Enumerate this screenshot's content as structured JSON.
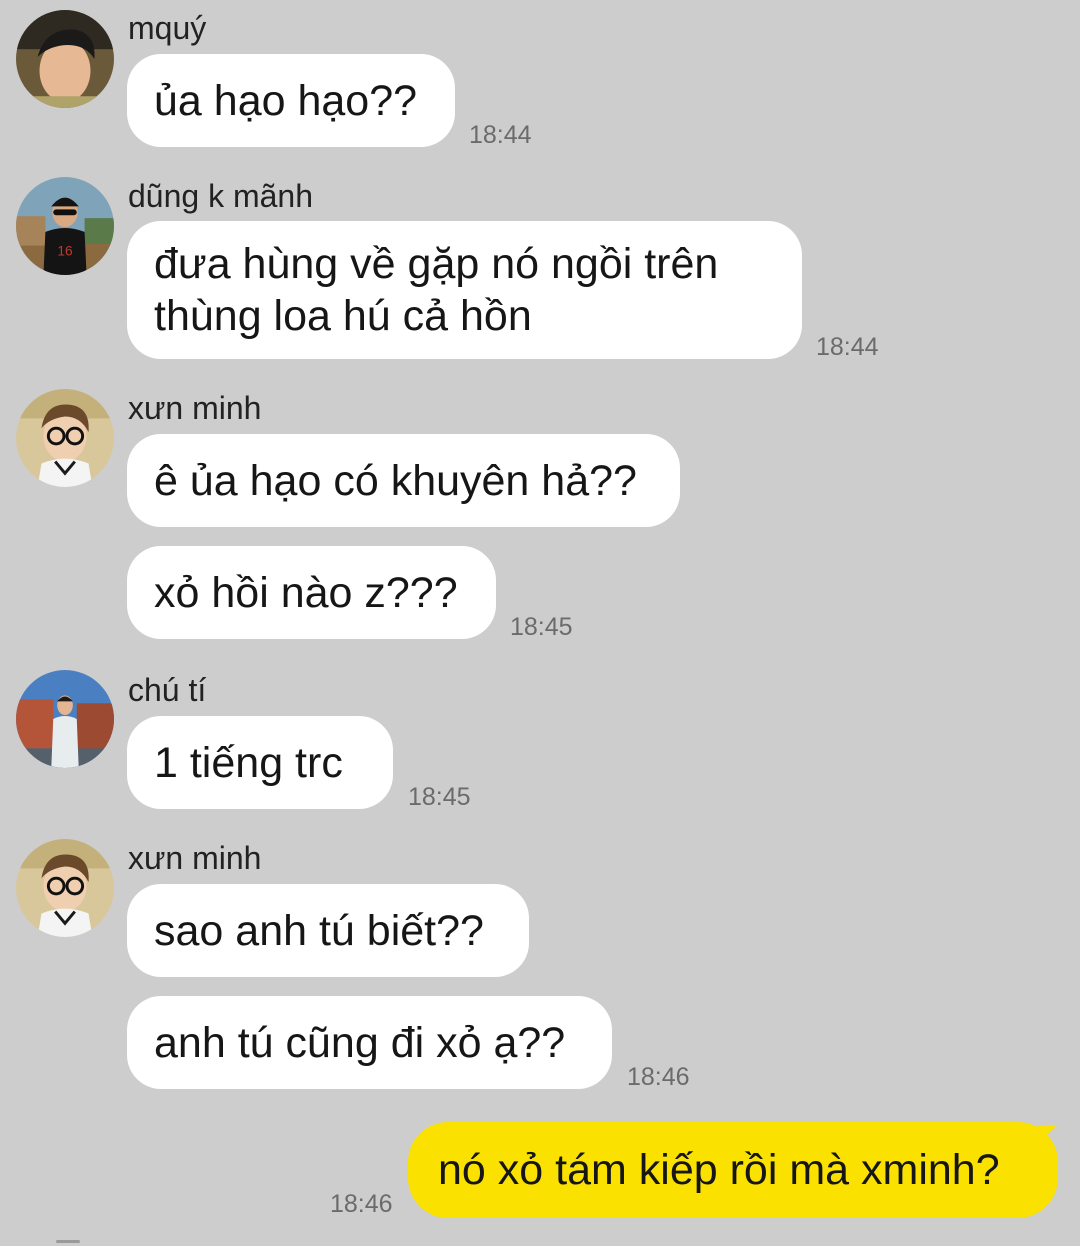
{
  "messages": [
    {
      "sender": "mquý",
      "avatar": "avatar-mquy",
      "bubbles": [
        "ủa hạo hạo??"
      ],
      "time": "18:44"
    },
    {
      "sender": "dũng k mãnh",
      "avatar": "avatar-dung-k-manh",
      "bubbles": [
        "đưa hùng về gặp nó ngồi trên thùng loa hú cả hồn"
      ],
      "time": "18:44"
    },
    {
      "sender": "xưn minh",
      "avatar": "avatar-xun-minh",
      "bubbles": [
        "ê ủa hạo có khuyên hả??",
        "xỏ hồi nào z???"
      ],
      "time": "18:45"
    },
    {
      "sender": "chú tí",
      "avatar": "avatar-chu-ti",
      "bubbles": [
        "1 tiếng trc"
      ],
      "time": "18:45"
    },
    {
      "sender": "xưn minh",
      "avatar": "avatar-xun-minh",
      "bubbles": [
        "sao anh tú biết??",
        "anh tú cũng đi xỏ ạ??"
      ],
      "time": "18:46"
    }
  ],
  "outgoing": {
    "text": "nó xỏ tám kiếp rồi mà xminh?",
    "time": "18:46"
  },
  "colors": {
    "background": "#cdcdcd",
    "incoming_bubble": "#ffffff",
    "outgoing_bubble": "#fae100",
    "timestamp": "#6b6b6b"
  }
}
